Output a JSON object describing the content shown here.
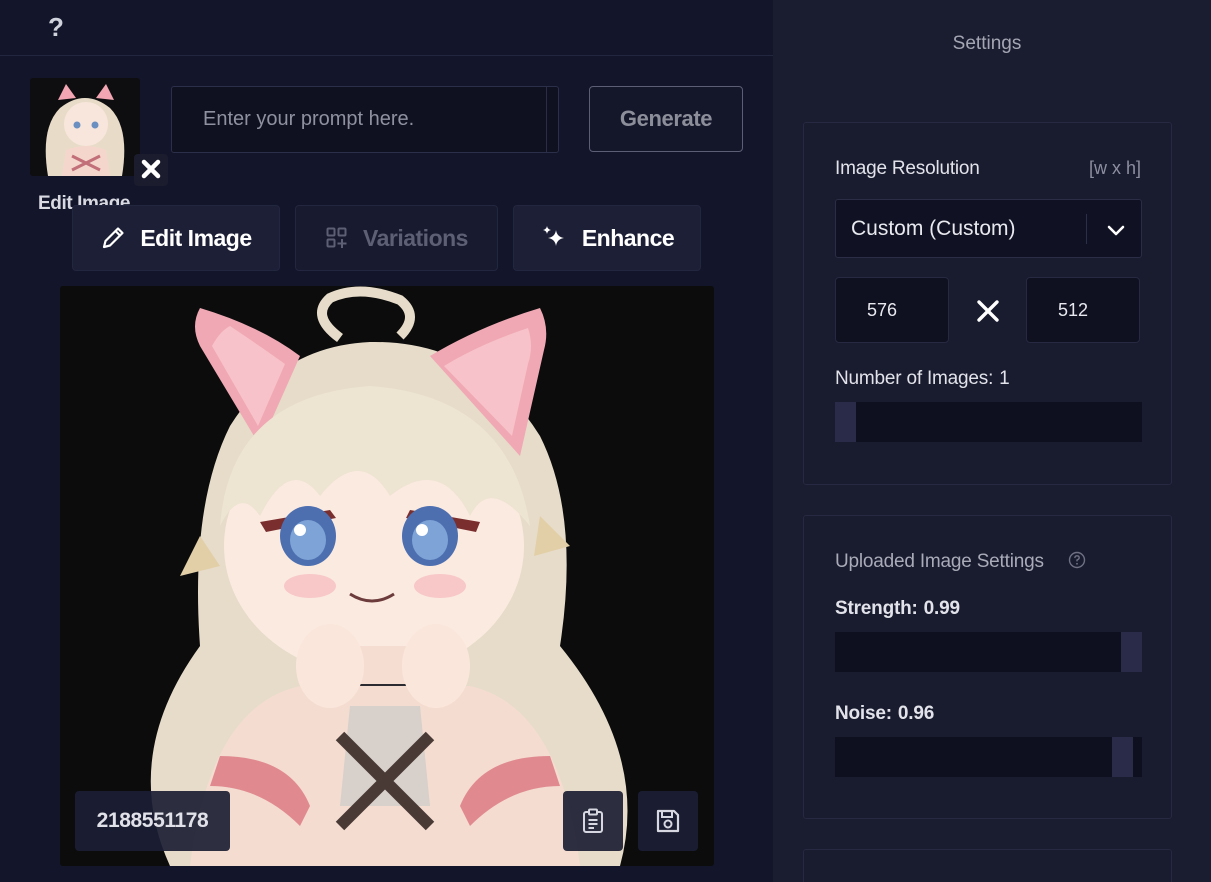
{
  "topbar": {
    "help_label": "?"
  },
  "upload": {
    "label": "Edit Image"
  },
  "prompt": {
    "placeholder": "Enter your prompt here.",
    "value": ""
  },
  "generate_label": "Generate",
  "actions": [
    {
      "label": "Edit Image",
      "icon": "pencil-icon",
      "enabled": true
    },
    {
      "label": "Variations",
      "icon": "grid-plus-icon",
      "enabled": false
    },
    {
      "label": "Enhance",
      "icon": "sparkles-icon",
      "enabled": true
    }
  ],
  "result": {
    "seed": "2188551178",
    "copy_icon": "clipboard-icon",
    "save_icon": "floppy-disk-icon"
  },
  "settings": {
    "title": "Settings",
    "resolution": {
      "label": "Image Resolution",
      "hint": "[w x h]",
      "selected": "Custom (Custom)",
      "width": "576",
      "height": "512"
    },
    "num_images": {
      "label": "Number of Images:",
      "value": "1"
    },
    "uploaded": {
      "title": "Uploaded Image Settings",
      "strength_label": "Strength:",
      "strength_value": "0.99",
      "noise_label": "Noise:",
      "noise_value": "0.96"
    }
  },
  "colors": {
    "background": "#13152b",
    "panel": "#1a1c30",
    "accent_slider": "#292b48"
  }
}
